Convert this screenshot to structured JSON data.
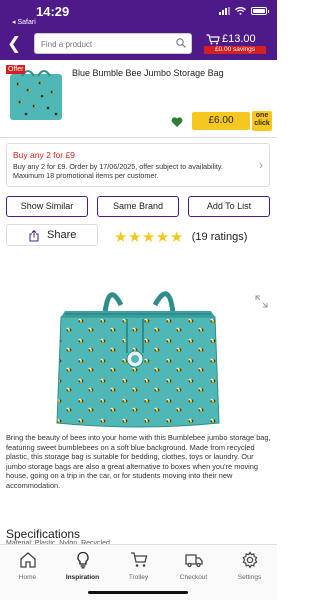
{
  "status": {
    "time": "14:29",
    "back_app": "◂ Safari"
  },
  "header": {
    "search_placeholder": "Find a product",
    "cart_total": "£13.00",
    "savings": "£0.00 savings"
  },
  "product": {
    "offer_tag": "Offer",
    "title": "Blue Bumble Bee Jumbo Storage Bag",
    "price_button": "£6.00",
    "oneclick_line1": "one",
    "oneclick_line2": "click"
  },
  "promo": {
    "title": "Buy any 2 for £9",
    "text": "Buy any 2 for £9. Order by 17/06/2025, offer subject to availability. Maximum 18 promotional items per customer."
  },
  "actions": {
    "show_similar": "Show Similar",
    "same_brand": "Same Brand",
    "add_to_list": "Add To List",
    "share": "Share"
  },
  "rating": {
    "stars": 5,
    "text": "(19 ratings)"
  },
  "description": "Bring the beauty of bees into your home with this Bumblebee jumbo storage bag, featuring sweet bumblebees on a soft blue background. Made from recycled plastic, this storage bag is suitable for bedding, clothes, toys or laundry. Our jumbo storage bags are also a great alternative to boxes when you're moving house, going on a trip in the car, or for students moving into their new accommodation.",
  "specifications": {
    "title": "Specifications",
    "material": "Material: Plastic, Nylon, Recycled"
  },
  "tabs": [
    {
      "label": "Home"
    },
    {
      "label": "Inspiration"
    },
    {
      "label": "Trolley"
    },
    {
      "label": "Checkout"
    },
    {
      "label": "Settings"
    }
  ],
  "colors": {
    "brand": "#4e1a8a",
    "price_yellow": "#f4c81e",
    "offer_red": "#d42020",
    "wishlist_green": "#2e7d32",
    "bag_teal": "#49b5b3"
  }
}
